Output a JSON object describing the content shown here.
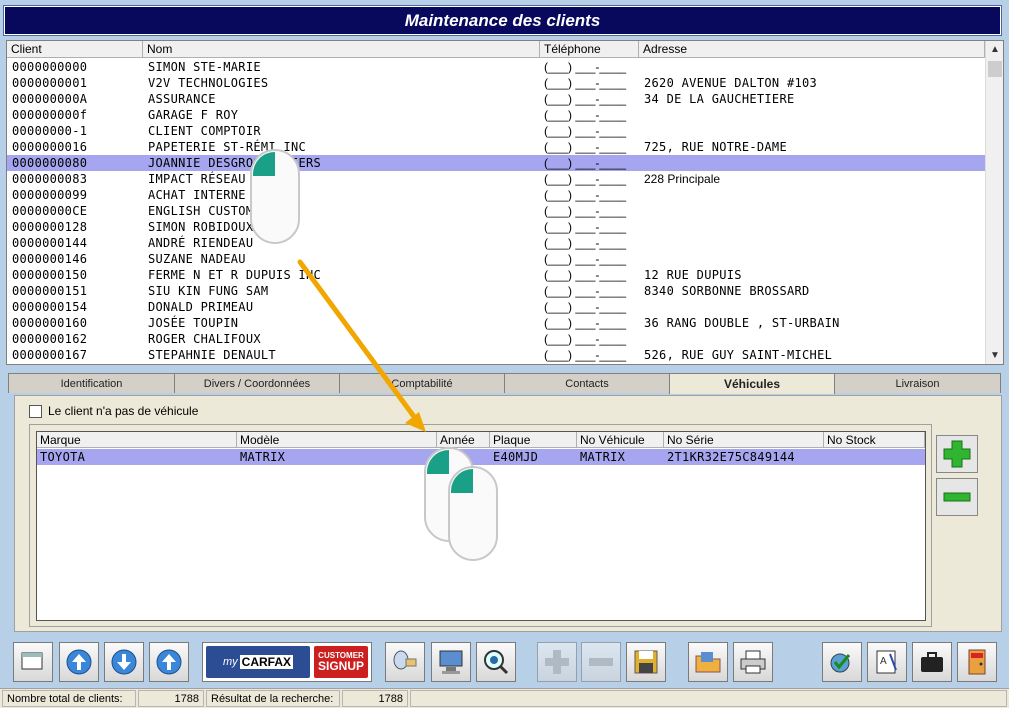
{
  "window": {
    "title": "Maintenance des clients"
  },
  "clients": {
    "columns": {
      "client": "Client",
      "nom": "Nom",
      "telephone": "Téléphone",
      "adresse": "Adresse"
    },
    "rows": [
      {
        "client": "0000000000",
        "nom": "SIMON STE-MARIE",
        "tel": "(___) ___-____",
        "adresse": ""
      },
      {
        "client": "0000000001",
        "nom": "V2V TECHNOLOGIES",
        "tel": "(___) ___-____",
        "adresse": "2620 AVENUE DALTON #103"
      },
      {
        "client": "000000000A",
        "nom": "ASSURANCE",
        "tel": "(___) ___-____",
        "adresse": "34 DE LA GAUCHETIERE"
      },
      {
        "client": "000000000f",
        "nom": "GARAGE F ROY",
        "tel": "(___) ___-____",
        "adresse": ""
      },
      {
        "client": "00000000-1",
        "nom": "CLIENT COMPTOIR",
        "tel": "(___) ___-____",
        "adresse": ""
      },
      {
        "client": "0000000016",
        "nom": "PAPETERIE ST-RÉMI INC",
        "tel": "(___) ___-____",
        "adresse": "725, RUE NOTRE-DAME"
      },
      {
        "client": "0000000080",
        "nom": "JOANNIE DESGROSEILLIERS",
        "tel": "(___) ___-____",
        "adresse": "",
        "selected": true
      },
      {
        "client": "0000000083",
        "nom": "IMPACT RÉSEAU",
        "tel": "(___) ___-____",
        "adresse": "228 Principale"
      },
      {
        "client": "0000000099",
        "nom": "ACHAT INTERNE",
        "tel": "(___) ___-____",
        "adresse": ""
      },
      {
        "client": "00000000CE",
        "nom": "ENGLISH CUSTOMER",
        "tel": "(___) ___-____",
        "adresse": ""
      },
      {
        "client": "0000000128",
        "nom": "SIMON ROBIDOUX",
        "tel": "(___) ___-____",
        "adresse": ""
      },
      {
        "client": "0000000144",
        "nom": "ANDRÉ RIENDEAU",
        "tel": "(___) ___-____",
        "adresse": ""
      },
      {
        "client": "0000000146",
        "nom": "SUZANE NADEAU",
        "tel": "(___) ___-____",
        "adresse": ""
      },
      {
        "client": "0000000150",
        "nom": "FERME N ET R DUPUIS INC",
        "tel": "(___) ___-____",
        "adresse": "12 RUE DUPUIS"
      },
      {
        "client": "0000000151",
        "nom": "SIU KIN FUNG SAM",
        "tel": "(___) ___-____",
        "adresse": "8340 SORBONNE BROSSARD"
      },
      {
        "client": "0000000154",
        "nom": "DONALD PRIMEAU",
        "tel": "(___) ___-____",
        "adresse": ""
      },
      {
        "client": "0000000160",
        "nom": "JOSÉE TOUPIN",
        "tel": "(___) ___-____",
        "adresse": "36 RANG DOUBLE , ST-URBAIN"
      },
      {
        "client": "0000000162",
        "nom": "ROGER CHALIFOUX",
        "tel": "(___) ___-____",
        "adresse": ""
      },
      {
        "client": "0000000167",
        "nom": "STEPAHNIE DENAULT",
        "tel": "(___) ___-____",
        "adresse": "526, RUE GUY SAINT-MICHEL"
      }
    ]
  },
  "tabs": [
    {
      "label": "Identification"
    },
    {
      "label": "Divers / Coordonnées"
    },
    {
      "label": "Comptabilité"
    },
    {
      "label": "Contacts"
    },
    {
      "label": "Véhicules",
      "active": true
    },
    {
      "label": "Livraison"
    }
  ],
  "vehicles": {
    "no_vehicle_label": "Le client n'a pas de véhicule",
    "columns": {
      "marque": "Marque",
      "modele": "Modèle",
      "annee": "Année",
      "plaque": "Plaque",
      "no_vehicule": "No Véhicule",
      "no_serie": "No Série",
      "no_stock": "No Stock"
    },
    "rows": [
      {
        "marque": "TOYOTA",
        "modele": "MATRIX",
        "annee": "",
        "plaque": "E40MJD",
        "no_vehicule": "MATRIX",
        "no_serie": "2T1KR32E75C849144",
        "no_stock": ""
      }
    ]
  },
  "carfax": {
    "brand_prefix": "my",
    "brand": "CARFAX",
    "signup_top": "CUSTOMER",
    "signup_bottom": "SIGNUP"
  },
  "status": {
    "total_label": "Nombre total de clients:",
    "total_value": "1788",
    "result_label": "Résultat de la recherche:",
    "result_value": "1788"
  }
}
